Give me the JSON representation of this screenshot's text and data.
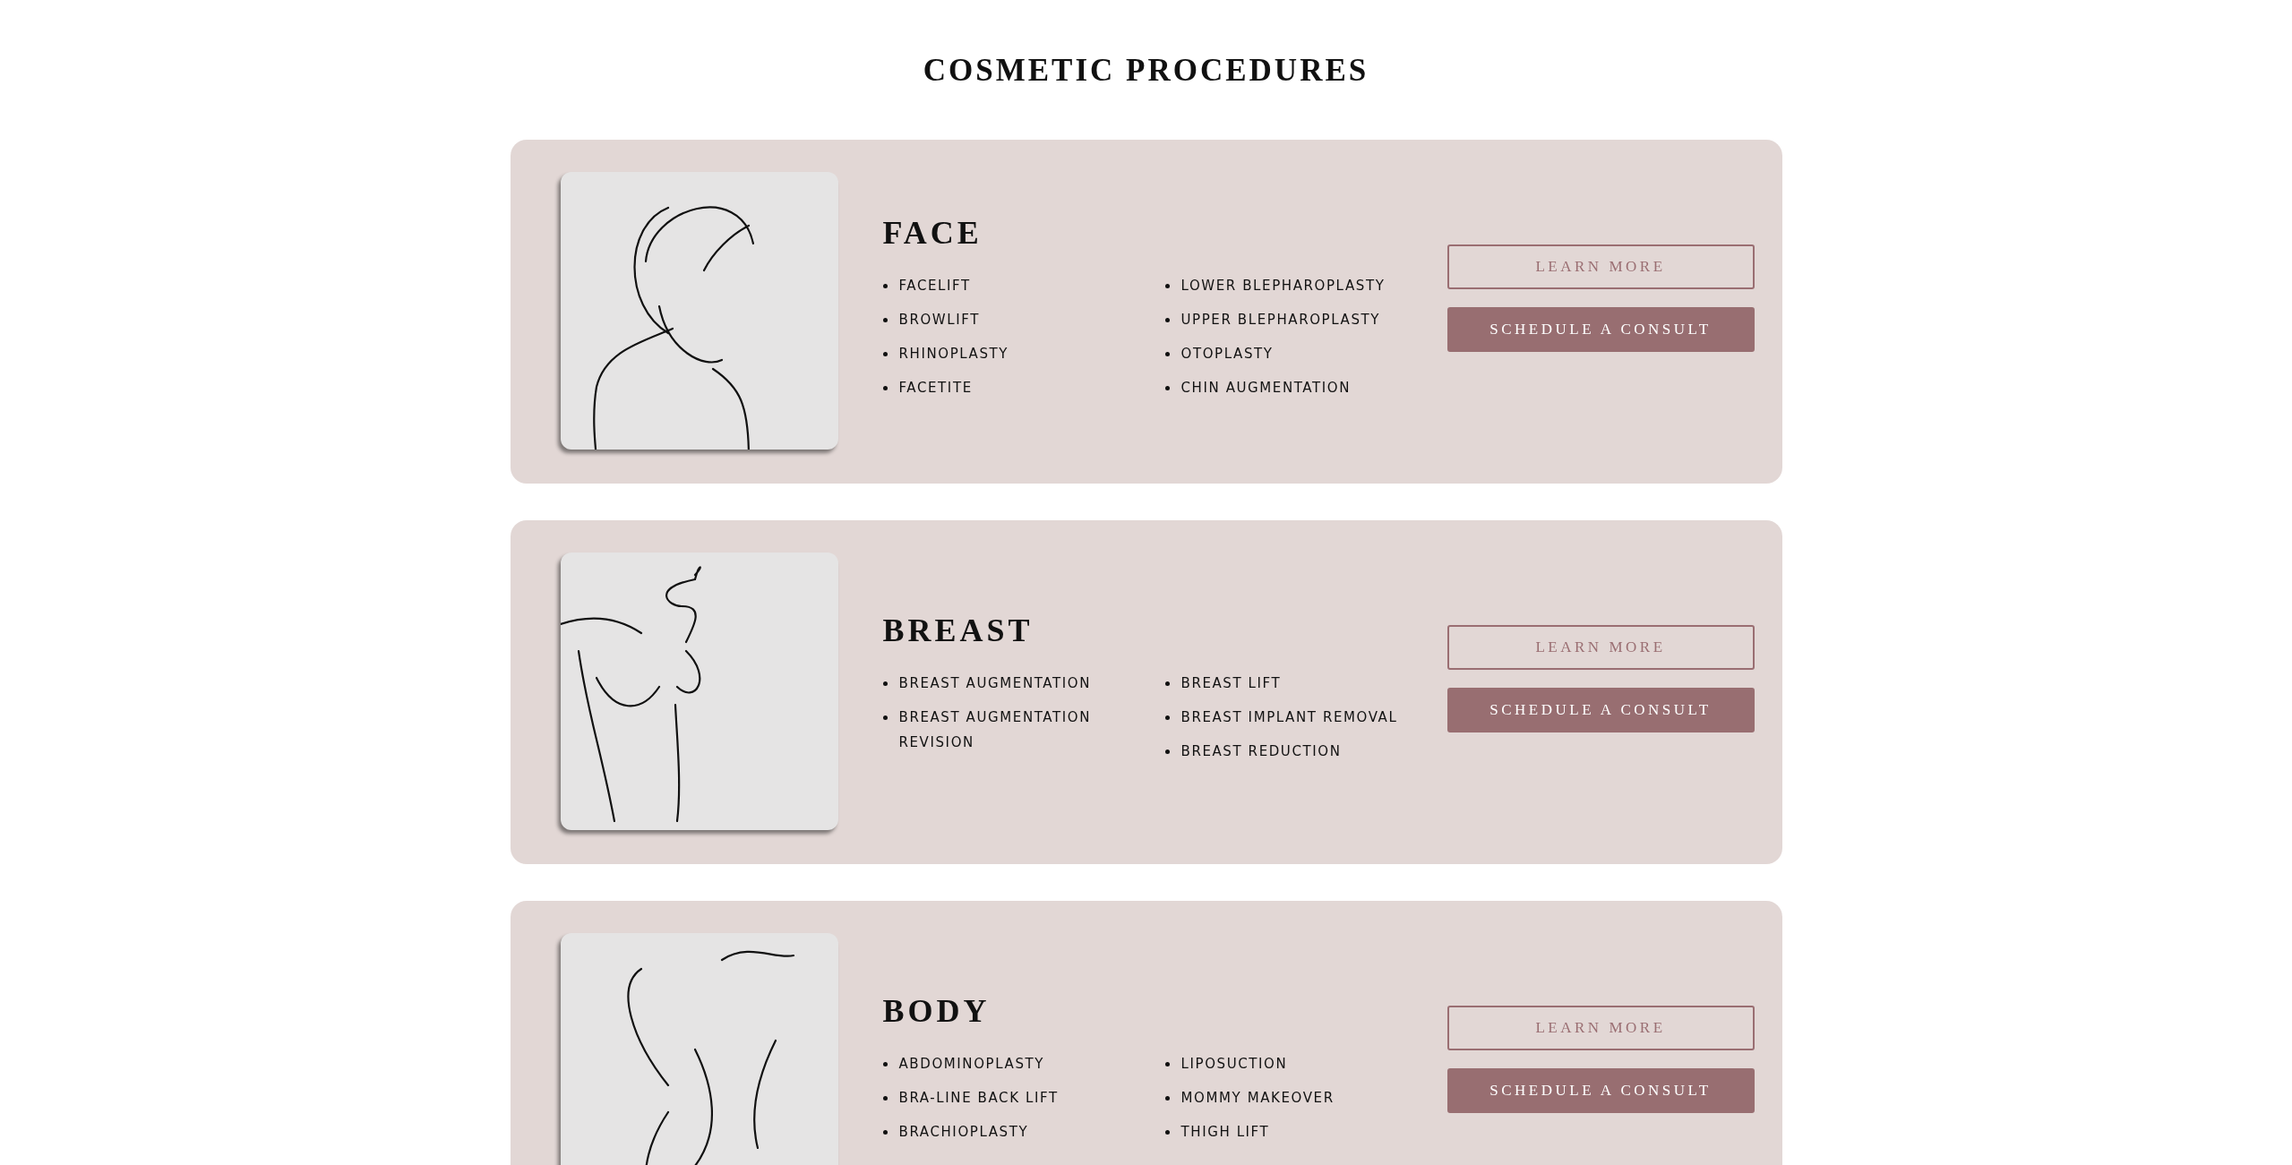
{
  "title": "COSMETIC PROCEDURES",
  "procedures": [
    {
      "kind": "face",
      "name": "FACE",
      "columns": [
        [
          "FACELIFT",
          "BROWLIFT",
          "RHINOPLASTY",
          "FACETITE"
        ],
        [
          "LOWER BLEPHAROPLASTY",
          "UPPER BLEPHAROPLASTY",
          "OTOPLASTY",
          "CHIN AUGMENTATION"
        ]
      ],
      "buttons": [
        "LEARN MORE",
        "SCHEDULE A CONSULT"
      ]
    },
    {
      "kind": "breast",
      "name": "BREAST",
      "columns": [
        [
          "BREAST AUGMENTATION",
          "BREAST AUGMENTATION REVISION"
        ],
        [
          "BREAST LIFT",
          "BREAST IMPLANT REMOVAL",
          "BREAST REDUCTION"
        ]
      ],
      "buttons": [
        "LEARN MORE",
        "SCHEDULE A CONSULT"
      ]
    },
    {
      "kind": "body",
      "name": "BODY",
      "columns": [
        [
          "ABDOMINOPLASTY",
          "BRA-LINE BACK LIFT",
          "BRACHIOPLASTY"
        ],
        [
          "LIPOSUCTION",
          "MOMMY MAKEOVER",
          "THIGH LIFT"
        ]
      ],
      "buttons": [
        "LEARN MORE",
        "SCHEDULE A CONSULT"
      ]
    }
  ]
}
